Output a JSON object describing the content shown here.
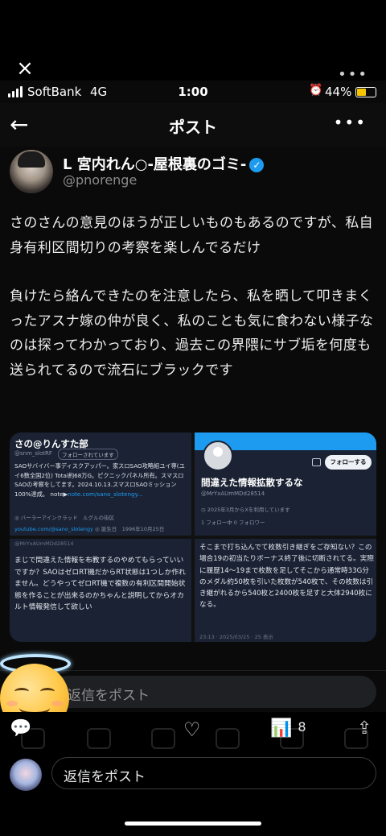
{
  "viewer": {
    "close_glyph": "×",
    "more_glyph": "•••"
  },
  "status_bar": {
    "carrier": "SoftBank",
    "network": "4G",
    "time": "1:00",
    "battery_percent": "44%",
    "battery_level": 0.44,
    "alarm_glyph": "⏰"
  },
  "nav": {
    "back_glyph": "←",
    "title": "ポスト",
    "more_glyph": "•••"
  },
  "post": {
    "display_name": "L 宮内れん○-屋根裏のゴミ-",
    "verified_glyph": "✓",
    "handle": "@pnorenge",
    "paragraphs": [
      "さのさんの意見のほうが正しいものもあるのですが、私自身有利区間切りの考察を楽しんでるだけ",
      "負けたら絡んできたのを注意したら、私を晒して叩きまくったアスナ嫁の仲が良く、私のことも気に食わない様子なのは探ってわかっており、過去この界隈にサブ垢を何度も送られてるので流石にブラックです"
    ]
  },
  "media": {
    "profile_sano": {
      "name": "さの@りんすた部",
      "handle": "@snm_slotRF",
      "follows_badge": "フォローされています",
      "bio": "SAOサバイバー事ディスクアッパー。家スロSAO攻略組ユイ専(ユイ6数全国2位) Total約68万G。ピクニックパネル所有。スマスロSAOの考察をしてます。2024.10.13.スマスロSAOミッション100%達成。",
      "bio_link_prefix": "note▶",
      "bio_link": "note.com/sano_slotengy...",
      "location": "◎ バーラーアインクラッド　ルグルの街区",
      "website": "youtube.com/@sano_slotengy",
      "birth": "◎ 誕生日　1996年10月25日"
    },
    "profile_misinfo": {
      "name": "間違えた情報拡散するな",
      "handle": "@MrYxAUmMDd28514",
      "follow_button": "フォローする",
      "joined": "◷ 2025年3月からXを利用しています",
      "following": "1 フォロー中",
      "followers": "0 フォロワー"
    },
    "reply_left": {
      "top_handle": "@MrYxAUmMDd28514",
      "text": "まじで間違えた情報を布教するのやめてもらっていいですか？SAOはゼロRT機だからRT状態は1つしか作れません。どうやってゼロRT機で複数の有利区間開始状態を作ることが出来るのかちゃんと説明してからオカルト情報発信して欲しい"
    },
    "reply_right": {
      "text": "そこまで打ち込んでて枚数引き継ぎをご存知ない？この場合19の初当たりボーナス終了後に切断されてる。実際に履歴14〜19まで枚数を足してそこから通常時33G分のメダル約50枚を引いた枚数が540枚で、その枚数は引き継がれるから540枚と2400枚を足すと大体2940枚になる。",
      "footer": "23:13 · 2025/03/25 · 25 表示"
    }
  },
  "reply_bar": {
    "placeholder": "返信をポスト"
  },
  "actions": {
    "reply_glyph": "💬",
    "like_glyph": "♡",
    "views_glyph": "📊",
    "views_count": "8",
    "share_glyph": "⇪"
  },
  "composer": {
    "placeholder": "返信をポスト"
  }
}
